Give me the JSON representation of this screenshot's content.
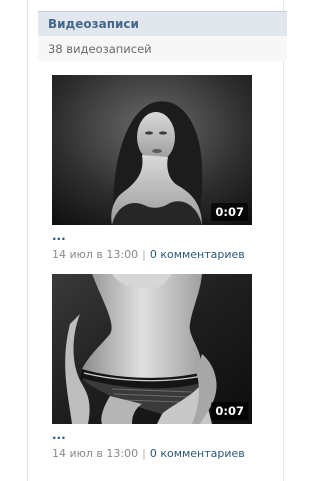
{
  "section": {
    "title": "Видеозаписи",
    "count_label": "38 видеозаписей"
  },
  "videos": [
    {
      "title": "...",
      "duration": "0:07",
      "date": "14 июл в 13:00",
      "separator": "|",
      "comments": "0 комментариев"
    },
    {
      "title": "...",
      "duration": "0:07",
      "date": "14 июл в 13:00",
      "separator": "|",
      "comments": "0 комментариев"
    }
  ],
  "colors": {
    "header_bg": "#e1e7ed",
    "header_text": "#45688e",
    "link": "#2b587a",
    "meta_text": "#8a8a8a"
  }
}
